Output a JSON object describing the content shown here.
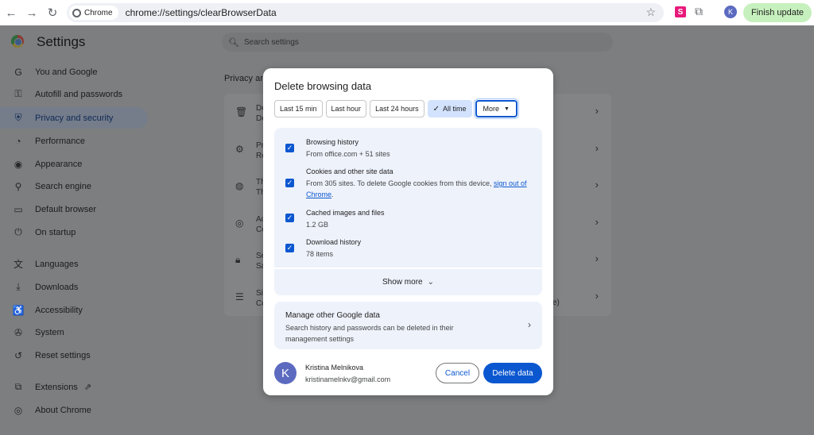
{
  "browser": {
    "back_icon": "arrow-left-icon",
    "forward_icon": "arrow-right-icon",
    "reload_icon": "reload-icon",
    "site_chip": "Chrome",
    "url": "chrome://settings/clearBrowserData",
    "profile_initial": "K",
    "extension_label": "S",
    "finish_update": "Finish update"
  },
  "settings": {
    "title": "Settings",
    "search_placeholder": "Search settings",
    "section_title": "Privacy ar",
    "nav": [
      {
        "label": "You and Google",
        "icon": "google-g-icon"
      },
      {
        "label": "Autofill and passwords",
        "icon": "key-icon"
      },
      {
        "label": "Privacy and security",
        "icon": "shield-icon",
        "active": true
      },
      {
        "label": "Performance",
        "icon": "speedometer-icon"
      },
      {
        "label": "Appearance",
        "icon": "palette-icon"
      },
      {
        "label": "Search engine",
        "icon": "search-icon"
      },
      {
        "label": "Default browser",
        "icon": "browser-window-icon"
      },
      {
        "label": "On startup",
        "icon": "power-icon"
      },
      {
        "label": "Languages",
        "icon": "translate-icon"
      },
      {
        "label": "Downloads",
        "icon": "download-icon"
      },
      {
        "label": "Accessibility",
        "icon": "accessibility-icon"
      },
      {
        "label": "System",
        "icon": "wrench-icon"
      },
      {
        "label": "Reset settings",
        "icon": "history-icon"
      },
      {
        "label": "Extensions",
        "icon": "puzzle-icon"
      },
      {
        "label": "About Chrome",
        "icon": "chrome-icon"
      }
    ],
    "card_rows": [
      {
        "line1": "De",
        "line2": "De"
      },
      {
        "line1": "Pr",
        "line2": "Re"
      },
      {
        "line1": "Th",
        "line2": "Th"
      },
      {
        "line1": "Ac",
        "line2": "Co"
      },
      {
        "line1": "Se",
        "line2": "Sa"
      },
      {
        "line1": "Si",
        "line2": "Co",
        "trail": "e)"
      }
    ]
  },
  "dialog": {
    "title": "Delete browsing data",
    "time_ranges": [
      "Last 15 min",
      "Last hour",
      "Last 24 hours",
      "All time",
      "More"
    ],
    "selected_range": "All time",
    "items": [
      {
        "title": "Browsing history",
        "desc": "From office.com + 51 sites",
        "checked": true
      },
      {
        "title": "Cookies and other site data",
        "desc": "From 305 sites. To delete Google cookies from this device, ",
        "link": "sign out of Chrome",
        "desc_end": ".",
        "checked": true
      },
      {
        "title": "Cached images and files",
        "desc": "1.2 GB",
        "checked": true
      },
      {
        "title": "Download history",
        "desc": "78 items",
        "checked": true
      }
    ],
    "show_more": "Show more",
    "manage_title": "Manage other Google data",
    "manage_desc": "Search history and passwords can be deleted in their management settings",
    "account_initial": "K",
    "account_name": "Kristina Melnikova",
    "account_email": "kristinamelnkv@gmail.com",
    "cancel_label": "Cancel",
    "delete_label": "Delete data"
  },
  "colors": {
    "accent": "#0b57d0",
    "selected_chip": "#d3e3fd",
    "finish_update_bg": "#c6f0bd",
    "avatar": "#5c6bc0"
  }
}
